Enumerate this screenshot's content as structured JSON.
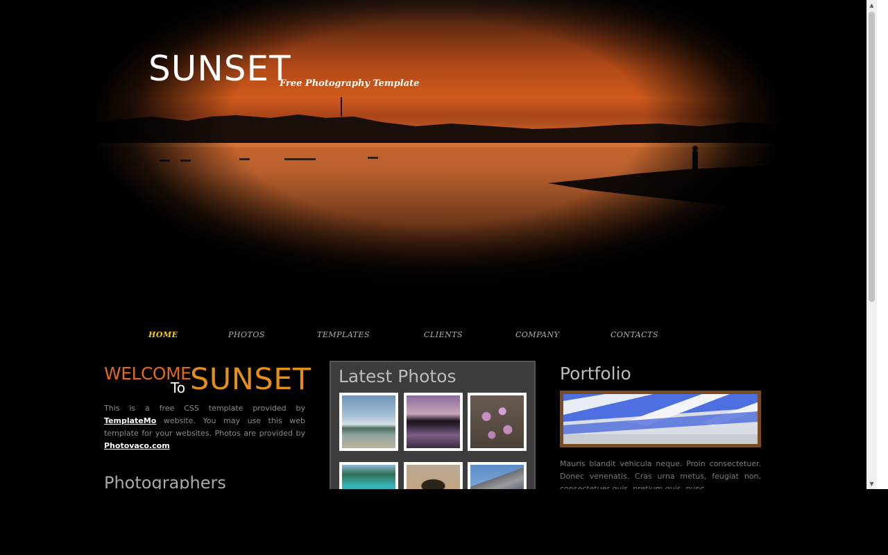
{
  "header": {
    "title": "SUNSET",
    "tagline": "Free Photography Template"
  },
  "nav": {
    "items": [
      "HOME",
      "PHOTOS",
      "TEMPLATES",
      "CLIENTS",
      "COMPANY",
      "CONTACTS"
    ],
    "active": "HOME"
  },
  "welcome": {
    "word1": "WELCOME",
    "word2": "To",
    "word3": "SUNSET",
    "text_part1": "This is a free CSS template provided by ",
    "link1": "TemplateMo",
    "text_part2": " website. You may use this web template for your websites. Photos are provided by ",
    "link2": "Photovaco.com"
  },
  "photographers": {
    "heading": "Photographers"
  },
  "latest_photos": {
    "heading": "Latest Photos",
    "thumbs": [
      "beach-photo",
      "dusk-lake-photo",
      "wildflowers-photo",
      "coast-photo",
      "tree-photo",
      "mountains-photo"
    ]
  },
  "portfolio": {
    "heading": "Portfolio",
    "text": "Mauris blandit vehicula neque. Proin consectetuer. Donec venenatis. Cras urna metus, feugiat non, consectetuer quis, pretium quis, nunc."
  },
  "colors": {
    "background": "#000000",
    "nav_active": "#ffcc00",
    "welcome_orange": "#e06a1b",
    "sunset_orange": "#e3901a",
    "panel_gray": "#3c3c3c"
  }
}
